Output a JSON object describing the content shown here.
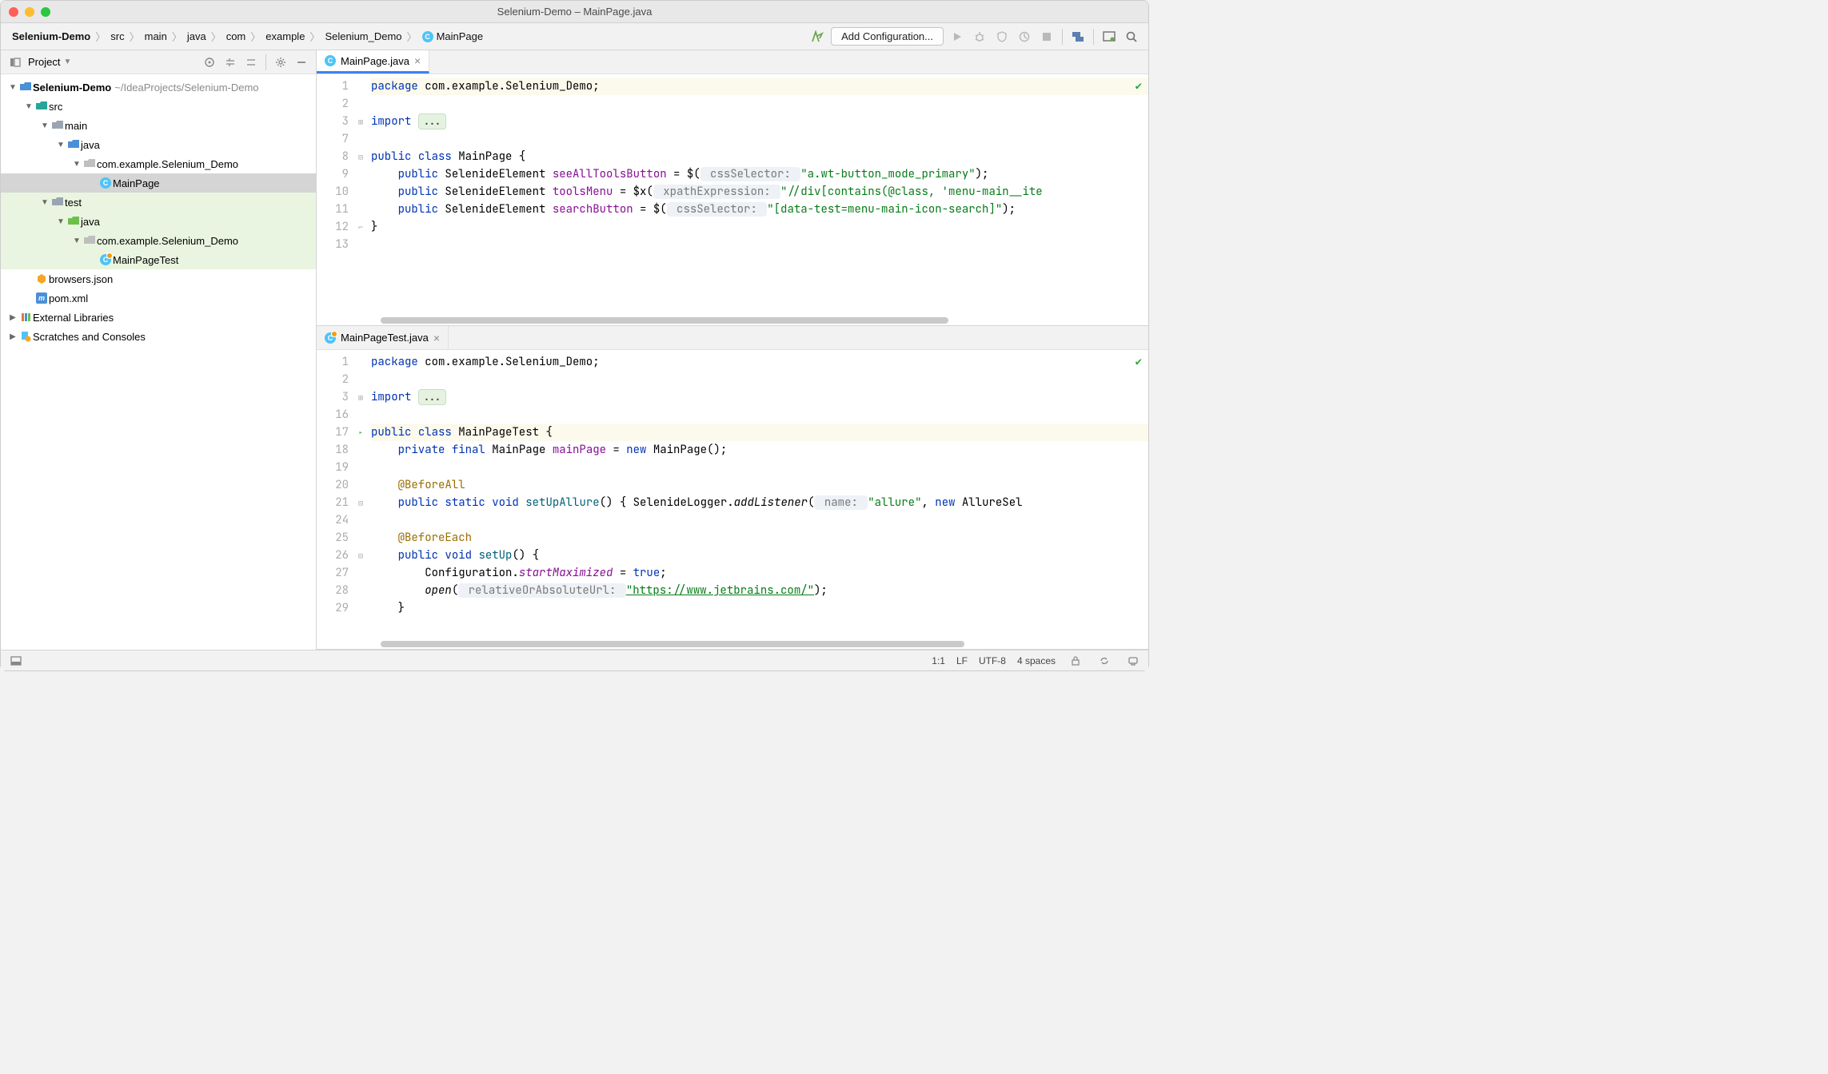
{
  "window": {
    "title": "Selenium-Demo – MainPage.java"
  },
  "breadcrumbs": {
    "items": [
      "Selenium-Demo",
      "src",
      "main",
      "java",
      "com",
      "example",
      "Selenium_Demo",
      "MainPage"
    ]
  },
  "toolbar": {
    "add_config": "Add Configuration..."
  },
  "sidebar": {
    "title": "Project",
    "root": {
      "label": "Selenium-Demo",
      "path": "~/IdeaProjects/Selenium-Demo"
    },
    "items": [
      {
        "label": "src"
      },
      {
        "label": "main"
      },
      {
        "label": "java"
      },
      {
        "label": "com.example.Selenium_Demo"
      },
      {
        "label": "MainPage"
      },
      {
        "label": "test"
      },
      {
        "label": "java"
      },
      {
        "label": "com.example.Selenium_Demo"
      },
      {
        "label": "MainPageTest"
      },
      {
        "label": "browsers.json"
      },
      {
        "label": "pom.xml"
      },
      {
        "label": "External Libraries"
      },
      {
        "label": "Scratches and Consoles"
      }
    ]
  },
  "editors": {
    "top": {
      "tab": "MainPage.java",
      "gutter": [
        "1",
        "2",
        "3",
        "7",
        "8",
        "9",
        "10",
        "11",
        "12",
        "13"
      ],
      "code": {
        "l1_pkg": "package",
        "l1_rest": " com.example.Selenium_Demo;",
        "l3_imp": "import",
        "l3_dots": "...",
        "l5_pub": "public",
        "l5_class": "class",
        "l5_name": " MainPage {",
        "l6_pub": "public",
        "l6_type": " SelenideElement ",
        "l6_fld": "seeAllToolsButton",
        "l6_eq": " = $(",
        "l6_hint": " cssSelector: ",
        "l6_str": "\"a.wt-button_mode_primary\"",
        "l6_end": ");",
        "l7_pub": "public",
        "l7_type": " SelenideElement ",
        "l7_fld": "toolsMenu",
        "l7_eq": " = $x(",
        "l7_hint": " xpathExpression: ",
        "l7_str": "\"//div[contains(@class, 'menu-main__ite",
        "l8_pub": "public",
        "l8_type": " SelenideElement ",
        "l8_fld": "searchButton",
        "l8_eq": " = $(",
        "l8_hint": " cssSelector: ",
        "l8_str": "\"[data-test=menu-main-icon-search]\"",
        "l8_end": ");",
        "l9_close": "}"
      }
    },
    "bottom": {
      "tab": "MainPageTest.java",
      "gutter": [
        "1",
        "2",
        "3",
        "16",
        "17",
        "18",
        "19",
        "20",
        "21",
        "24",
        "25",
        "26",
        "27",
        "28",
        "29"
      ],
      "code": {
        "b1_pkg": "package",
        "b1_rest": " com.example.Selenium_Demo;",
        "b3_imp": "import",
        "b3_dots": "...",
        "b5_pub": "public",
        "b5_class": "class",
        "b5_name": " MainPageTest {",
        "b6_priv": "private",
        "b6_final": "final",
        "b6_type": " MainPage ",
        "b6_fld": "mainPage",
        "b6_eq": " = ",
        "b6_new": "new",
        "b6_ctor": " MainPage();",
        "b8_ann": "@BeforeAll",
        "b9_pub": "public",
        "b9_static": "static",
        "b9_void": "void",
        "b9_name": "setUpAllure",
        "b9_body1": "() { SelenideLogger.",
        "b9_call": "addListener",
        "b9_open": "(",
        "b9_hint": " name: ",
        "b9_str": "\"allure\"",
        "b9_comma": ", ",
        "b9_new": "new",
        "b9_rest": " AllureSel",
        "b11_ann": "@BeforeEach",
        "b12_pub": "public",
        "b12_void": "void",
        "b12_name": "setUp",
        "b12_rest": "() {",
        "b13_cfg": "Configuration.",
        "b13_fld": "startMaximized",
        "b13_eq": " = ",
        "b13_true": "true",
        "b13_semi": ";",
        "b14_open": "open",
        "b14_paren": "(",
        "b14_hint": " relativeOrAbsoluteUrl: ",
        "b14_url": "\"https://www.jetbrains.com/\"",
        "b14_end": ");",
        "b15_close": "}"
      }
    }
  },
  "status": {
    "pos": "1:1",
    "lf": "LF",
    "enc": "UTF-8",
    "indent": "4 spaces"
  }
}
